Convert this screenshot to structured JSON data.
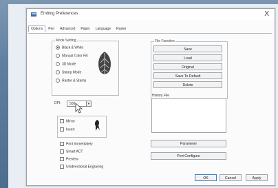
{
  "window": {
    "title": "Emblog Preferences",
    "close": "X"
  },
  "tabs": [
    "Options",
    "Pen",
    "Advanced",
    "Paper",
    "Language",
    "Raster"
  ],
  "mode_setting": {
    "label": "Mode Setting",
    "options": [
      "Black & White",
      "Manual Color Fill",
      "3D Mode",
      "Stamp Mode",
      "Raster & Stamp"
    ]
  },
  "dpi": {
    "label": "DPI:",
    "value": "500"
  },
  "mirror": {
    "options": [
      "Mirror",
      "Invert"
    ]
  },
  "checkboxes": [
    "Print Immediately",
    "Smart ACT",
    "Preview",
    "Unidirectional Engraving"
  ],
  "file_function": {
    "label": "File Function",
    "buttons": [
      "Save",
      "Load",
      "Original",
      "Save To Default",
      "Delete"
    ]
  },
  "history": {
    "label": "History File"
  },
  "side_buttons": [
    "Parameter",
    "Port Configure"
  ],
  "footer_buttons": [
    "OK",
    "Cancel",
    "Apply"
  ]
}
